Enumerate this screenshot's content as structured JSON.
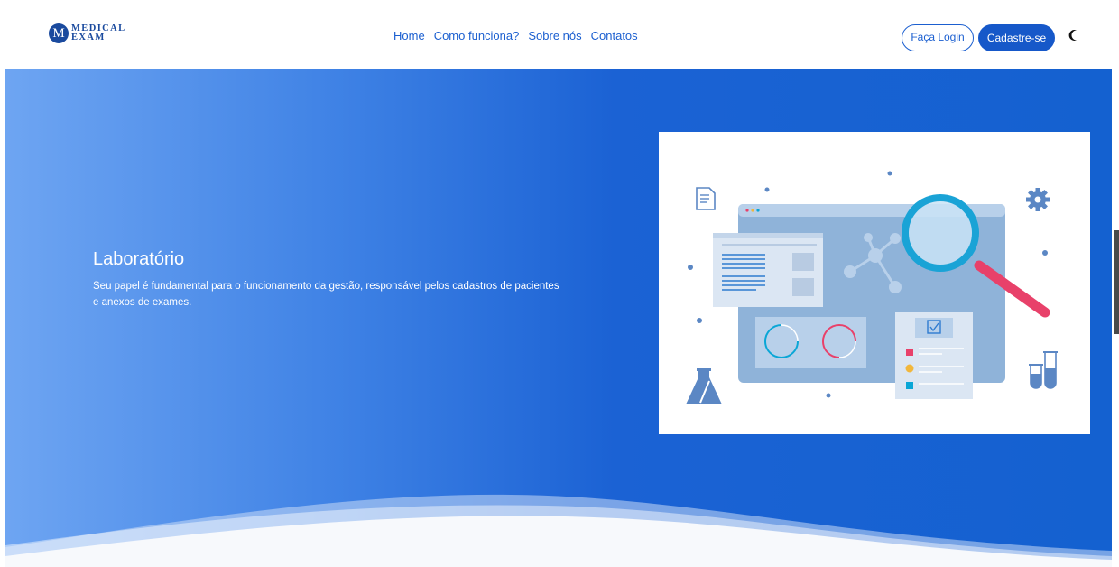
{
  "brand": {
    "mark": "M",
    "line1": "MEDICAL",
    "line2": "EXAM"
  },
  "nav": [
    {
      "label": "Home"
    },
    {
      "label": "Como funciona?"
    },
    {
      "label": "Sobre nós"
    },
    {
      "label": "Contatos"
    }
  ],
  "auth": {
    "login_label": "Faça Login",
    "signup_label": "Cadastre-se"
  },
  "theme_toggle": {
    "icon": "moon-icon"
  },
  "hero": {
    "title": "Laboratório",
    "description": "Seu papel é fundamental para o funcionamento da gestão, responsável pelos cadastros de pacientes e anexos de exames."
  },
  "colors": {
    "primary": "#1658c9",
    "hero_gradient_start": "#6ea5f2",
    "hero_gradient_end": "#1461d0",
    "accent_pink": "#e8416a",
    "accent_teal": "#0aa6d6",
    "accent_yellow": "#f2b73c"
  }
}
